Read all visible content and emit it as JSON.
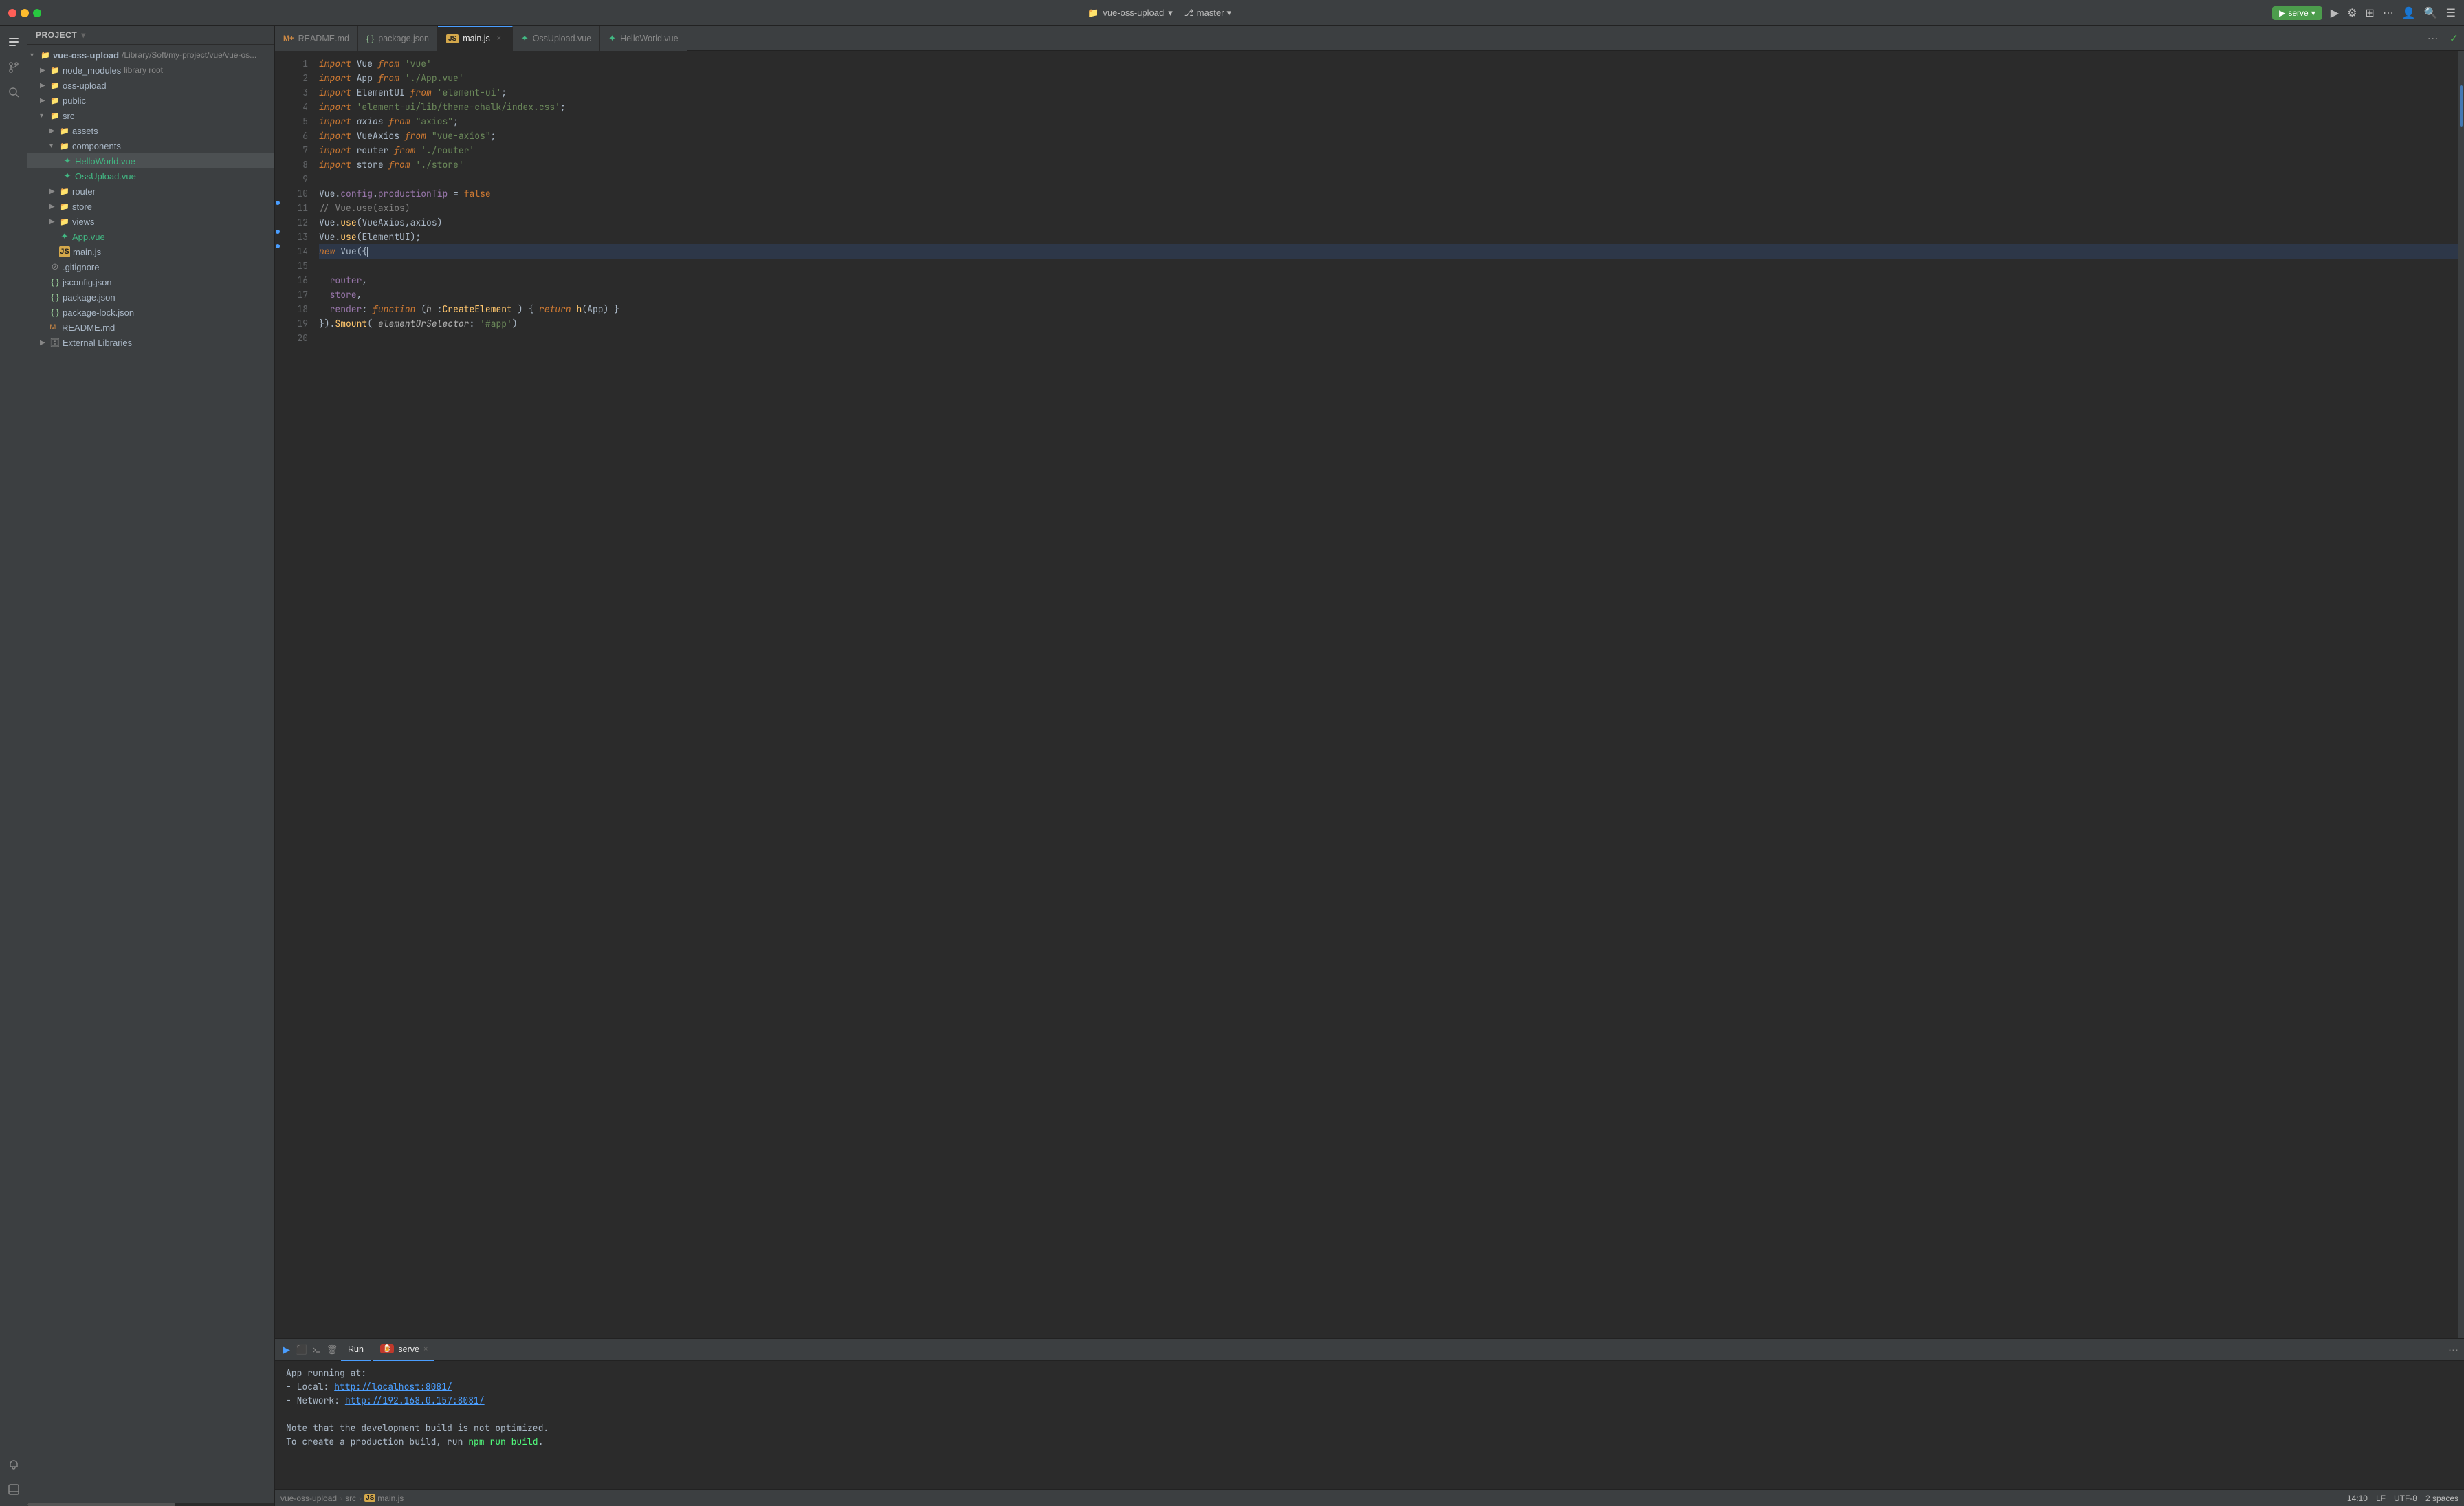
{
  "titlebar": {
    "project_name": "vue-oss-upload",
    "branch": "master",
    "serve_label": "serve",
    "chevron": "▾"
  },
  "tabs": [
    {
      "id": "readme",
      "icon": "M+",
      "label": "README.md",
      "active": false,
      "closable": false
    },
    {
      "id": "package",
      "icon": "{}",
      "label": "package.json",
      "active": false,
      "closable": false
    },
    {
      "id": "main",
      "icon": "JS",
      "label": "main.js",
      "active": true,
      "closable": true
    },
    {
      "id": "ossupload",
      "icon": "V",
      "label": "OssUpload.vue",
      "active": false,
      "closable": false
    },
    {
      "id": "helloworld",
      "icon": "V",
      "label": "HelloWorld.vue",
      "active": false,
      "closable": false
    }
  ],
  "sidebar": {
    "header": "Project",
    "tree": [
      {
        "level": 0,
        "type": "folder",
        "label": "vue-oss-upload",
        "path": "/Library/Soft/my-project/vue/vue-os...",
        "expanded": true,
        "color": "#a9b7c6"
      },
      {
        "level": 1,
        "type": "folder",
        "label": "node_modules",
        "sublabel": "library root",
        "expanded": false,
        "color": "#7ec8e3"
      },
      {
        "level": 1,
        "type": "folder",
        "label": "oss-upload",
        "expanded": false,
        "color": "#7ec8e3"
      },
      {
        "level": 1,
        "type": "folder",
        "label": "public",
        "expanded": false,
        "color": "#7ec8e3"
      },
      {
        "level": 1,
        "type": "folder",
        "label": "src",
        "expanded": true,
        "color": "#7ec8e3"
      },
      {
        "level": 2,
        "type": "folder",
        "label": "assets",
        "expanded": false,
        "color": "#7ec8e3"
      },
      {
        "level": 2,
        "type": "folder",
        "label": "components",
        "expanded": true,
        "color": "#7ec8e3"
      },
      {
        "level": 3,
        "type": "vue",
        "label": "HelloWorld.vue",
        "selected": true
      },
      {
        "level": 3,
        "type": "vue",
        "label": "OssUpload.vue"
      },
      {
        "level": 2,
        "type": "folder",
        "label": "router",
        "expanded": false,
        "color": "#7ec8e3"
      },
      {
        "level": 2,
        "type": "folder",
        "label": "store",
        "expanded": false,
        "color": "#7ec8e3"
      },
      {
        "level": 2,
        "type": "folder",
        "label": "views",
        "expanded": false,
        "color": "#7ec8e3"
      },
      {
        "level": 2,
        "type": "vue",
        "label": "App.vue"
      },
      {
        "level": 2,
        "type": "js",
        "label": "main.js"
      },
      {
        "level": 1,
        "type": "gitignore",
        "label": ".gitignore"
      },
      {
        "level": 1,
        "type": "json",
        "label": "jsconfig.json"
      },
      {
        "level": 1,
        "type": "json",
        "label": "package.json"
      },
      {
        "level": 1,
        "type": "json",
        "label": "package-lock.json"
      },
      {
        "level": 1,
        "type": "md",
        "label": "README.md"
      },
      {
        "level": 1,
        "type": "libs",
        "label": "External Libraries"
      }
    ]
  },
  "editor": {
    "filename": "main.js",
    "lines": [
      {
        "num": 1,
        "tokens": [
          {
            "t": "import",
            "c": "kw"
          },
          {
            "t": " Vue ",
            "c": "var"
          },
          {
            "t": "from",
            "c": "kw"
          },
          {
            "t": " ",
            "c": ""
          },
          {
            "t": "'vue'",
            "c": "str"
          }
        ]
      },
      {
        "num": 2,
        "tokens": [
          {
            "t": "import",
            "c": "kw"
          },
          {
            "t": " App ",
            "c": "var"
          },
          {
            "t": "from",
            "c": "kw"
          },
          {
            "t": " ",
            "c": ""
          },
          {
            "t": "'./App.vue'",
            "c": "str"
          }
        ]
      },
      {
        "num": 3,
        "tokens": [
          {
            "t": "import",
            "c": "kw"
          },
          {
            "t": " ElementUI ",
            "c": "var"
          },
          {
            "t": "from",
            "c": "kw"
          },
          {
            "t": " ",
            "c": ""
          },
          {
            "t": "'element-ui'",
            "c": "str"
          },
          {
            "t": ";",
            "c": "punct"
          }
        ]
      },
      {
        "num": 4,
        "tokens": [
          {
            "t": "import",
            "c": "kw"
          },
          {
            "t": " ",
            "c": ""
          },
          {
            "t": "'element-ui/lib/theme-chalk/index.css'",
            "c": "str"
          },
          {
            "t": ";",
            "c": "punct"
          }
        ]
      },
      {
        "num": 5,
        "tokens": [
          {
            "t": "import",
            "c": "kw"
          },
          {
            "t": " ",
            "c": "italic-var"
          },
          {
            "t": "axios",
            "c": "italic-var"
          },
          {
            "t": " ",
            "c": ""
          },
          {
            "t": "from",
            "c": "kw"
          },
          {
            "t": " ",
            "c": ""
          },
          {
            "t": "\"axios\"",
            "c": "str"
          },
          {
            "t": ";",
            "c": "punct"
          }
        ]
      },
      {
        "num": 6,
        "tokens": [
          {
            "t": "import",
            "c": "kw"
          },
          {
            "t": " VueAxios ",
            "c": "var"
          },
          {
            "t": "from",
            "c": "kw"
          },
          {
            "t": " ",
            "c": ""
          },
          {
            "t": "\"vue-axios\"",
            "c": "str"
          },
          {
            "t": ";",
            "c": "punct"
          }
        ]
      },
      {
        "num": 7,
        "tokens": [
          {
            "t": "import",
            "c": "kw"
          },
          {
            "t": " router ",
            "c": "var"
          },
          {
            "t": "from",
            "c": "kw"
          },
          {
            "t": " ",
            "c": ""
          },
          {
            "t": "'./router'",
            "c": "str"
          }
        ]
      },
      {
        "num": 8,
        "tokens": [
          {
            "t": "import",
            "c": "kw"
          },
          {
            "t": " store ",
            "c": "var"
          },
          {
            "t": "from",
            "c": "kw"
          },
          {
            "t": " ",
            "c": ""
          },
          {
            "t": "'./store'",
            "c": "str"
          }
        ]
      },
      {
        "num": 9,
        "tokens": []
      },
      {
        "num": 10,
        "tokens": [
          {
            "t": "Vue",
            "c": "cls"
          },
          {
            "t": ".",
            "c": "punct"
          },
          {
            "t": "config",
            "c": "prop"
          },
          {
            "t": ".",
            "c": "punct"
          },
          {
            "t": "productionTip",
            "c": "prop"
          },
          {
            "t": " ",
            "c": ""
          },
          {
            "t": "=",
            "c": "punct"
          },
          {
            "t": " ",
            "c": ""
          },
          {
            "t": "false",
            "c": "kw2"
          }
        ]
      },
      {
        "num": 11,
        "tokens": [
          {
            "t": "// Vue.use(axios)",
            "c": "comment"
          }
        ]
      },
      {
        "num": 12,
        "tokens": [
          {
            "t": "Vue",
            "c": "cls"
          },
          {
            "t": ".",
            "c": "punct"
          },
          {
            "t": "use",
            "c": "fn"
          },
          {
            "t": "(",
            "c": "punct"
          },
          {
            "t": "VueAxios",
            "c": "var"
          },
          {
            "t": ",",
            "c": "punct"
          },
          {
            "t": "axios",
            "c": "var"
          },
          {
            "t": ")",
            "c": "punct"
          }
        ]
      },
      {
        "num": 13,
        "tokens": [
          {
            "t": "V",
            "c": "cls"
          },
          {
            "t": "ue",
            "c": "cls"
          },
          {
            "t": ".",
            "c": "punct"
          },
          {
            "t": "use",
            "c": "fn"
          },
          {
            "t": "(",
            "c": "punct"
          },
          {
            "t": "ElementUI",
            "c": "var"
          },
          {
            "t": ");",
            "c": "punct"
          }
        ]
      },
      {
        "num": 14,
        "tokens": [
          {
            "t": "new",
            "c": "kw"
          },
          {
            "t": " ",
            "c": ""
          },
          {
            "t": "Vue",
            "c": "cls"
          },
          {
            "t": "({",
            "c": "punct"
          },
          {
            "t": "CURSOR",
            "c": "cursor"
          }
        ]
      },
      {
        "num": 15,
        "tokens": []
      },
      {
        "num": 16,
        "tokens": [
          {
            "t": "  router",
            "c": "prop"
          },
          {
            "t": ",",
            "c": "punct"
          }
        ]
      },
      {
        "num": 17,
        "tokens": [
          {
            "t": "  store",
            "c": "prop"
          },
          {
            "t": ",",
            "c": "punct"
          }
        ]
      },
      {
        "num": 18,
        "tokens": [
          {
            "t": "  ",
            "c": ""
          },
          {
            "t": "render",
            "c": "prop"
          },
          {
            "t": ": ",
            "c": "punct"
          },
          {
            "t": "function",
            "c": "kw"
          },
          {
            "t": " (",
            "c": "punct"
          },
          {
            "t": "h",
            "c": "param"
          },
          {
            "t": " ",
            "c": ""
          },
          {
            "t": ":",
            "c": "punct"
          },
          {
            "t": "CreateElement",
            "c": "type"
          },
          {
            "t": " ) {",
            "c": "punct"
          },
          {
            "t": " return",
            "c": "kw"
          },
          {
            "t": " ",
            "c": ""
          },
          {
            "t": "h",
            "c": "fn"
          },
          {
            "t": "(",
            "c": "punct"
          },
          {
            "t": "App",
            "c": "var"
          },
          {
            "t": ") }",
            "c": "punct"
          }
        ]
      },
      {
        "num": 19,
        "tokens": [
          {
            "t": "})",
            "c": "punct"
          },
          {
            "t": ".",
            "c": "punct"
          },
          {
            "t": "$mount",
            "c": "fn"
          },
          {
            "t": "(",
            "c": "punct"
          },
          {
            "t": " ",
            "c": ""
          },
          {
            "t": "elementOrSelector",
            "c": "param"
          },
          {
            "t": ": ",
            "c": "punct"
          },
          {
            "t": "'#app'",
            "c": "str"
          },
          {
            "t": ")",
            "c": "punct"
          }
        ]
      },
      {
        "num": 20,
        "tokens": []
      }
    ]
  },
  "bottom_panel": {
    "run_tab": "Run",
    "serve_tab": "serve",
    "terminal": {
      "app_running": "App running at:",
      "local_label": "- Local:   ",
      "local_url": "http://localhost:8081/",
      "network_label": "- Network: ",
      "network_url": "http://192.168.0.157:8081/",
      "note_line1": "Note that the development build is not optimized.",
      "note_line2": "To create a production build, run ",
      "npm_cmd": "npm run build",
      "note_end": "."
    }
  },
  "statusbar": {
    "project": "vue-oss-upload",
    "src": "src",
    "file": "main.js",
    "position": "14:10",
    "line_ending": "LF",
    "encoding": "UTF-8",
    "indent": "2 spaces"
  },
  "activity_bar": {
    "icons": [
      {
        "name": "folder-icon",
        "glyph": "⬜"
      },
      {
        "name": "git-icon",
        "glyph": "⎇"
      },
      {
        "name": "search-icon",
        "glyph": "⚙"
      }
    ]
  }
}
